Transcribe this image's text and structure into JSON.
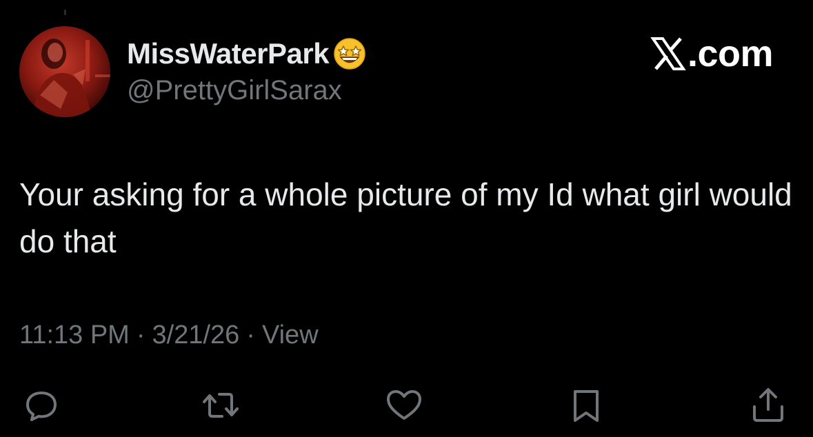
{
  "author": {
    "display_name": "MissWaterPark",
    "name_emoji": "star-struck-emoji",
    "handle": "@PrettyGirlSarax"
  },
  "brand": {
    "text": ".com",
    "logo": "x-logo-icon"
  },
  "tweet": {
    "text": "Your asking for a whole picture of my Id what girl would do that",
    "time": "11:13 PM",
    "date": "3/21/26",
    "views_label": "View",
    "separator": "·"
  },
  "actions": [
    {
      "name": "reply",
      "icon": "reply-icon"
    },
    {
      "name": "repost",
      "icon": "repost-icon"
    },
    {
      "name": "like",
      "icon": "heart-icon"
    },
    {
      "name": "bookmark",
      "icon": "bookmark-icon"
    },
    {
      "name": "share",
      "icon": "share-icon"
    }
  ],
  "colors": {
    "background": "#000000",
    "primary_text": "#e7e9ea",
    "secondary_text": "#71767b",
    "avatar_tint": "#b8261a"
  }
}
